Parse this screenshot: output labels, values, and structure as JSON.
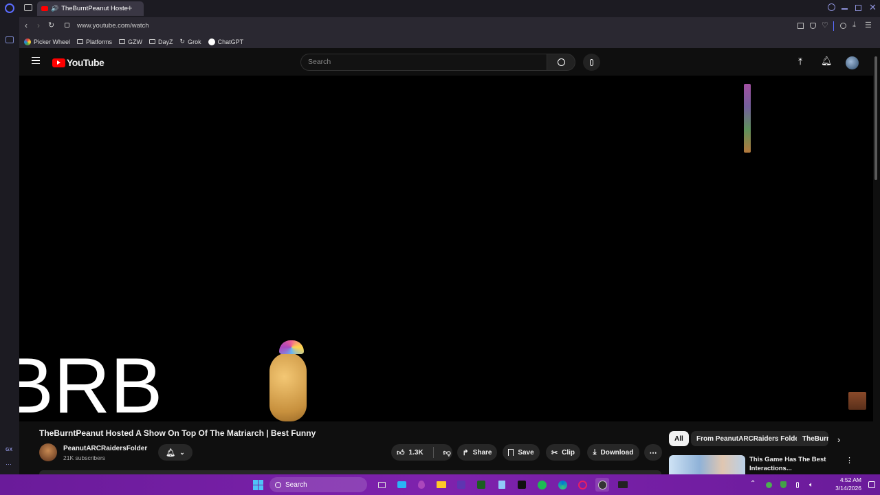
{
  "browser": {
    "tab_title": "TheBurntPeanut Hoste",
    "url": "www.youtube.com/watch",
    "sidebar_label": "GX",
    "bookmarks": [
      {
        "label": "Picker Wheel",
        "icon": "wheel-icon"
      },
      {
        "label": "Platforms",
        "icon": "folder-icon"
      },
      {
        "label": "GZW",
        "icon": "folder-icon"
      },
      {
        "label": "DayZ",
        "icon": "folder-icon"
      },
      {
        "label": "Grok",
        "icon": "grok-icon"
      },
      {
        "label": "ChatGPT",
        "icon": "chatgpt-icon"
      }
    ]
  },
  "youtube": {
    "logo_text": "YouTube",
    "search_placeholder": "Search"
  },
  "video": {
    "overlay_text": "BRB",
    "title": "TheBurntPeanut Hosted A Show On Top Of The Matriarch | Best Funny",
    "channel_name": "PeanutARCRaidersFolder",
    "subscribers": "21K subscribers",
    "likes": "1.3K",
    "share_label": "Share",
    "save_label": "Save",
    "clip_label": "Clip",
    "download_label": "Download"
  },
  "sidebar_chips": [
    "All",
    "From PeanutARCRaiders Folder",
    "TheBurnt"
  ],
  "recommended": {
    "title_line1": "This Game Has The Best",
    "title_line2": "Interactions..."
  },
  "taskbar": {
    "search_label": "Search",
    "time": "4:52 AM",
    "date": "3/14/2026"
  },
  "colors": {
    "yt_red": "#ff0000",
    "taskbar_purple": "#7b1fa2",
    "browser_dark": "#1c1b22"
  }
}
